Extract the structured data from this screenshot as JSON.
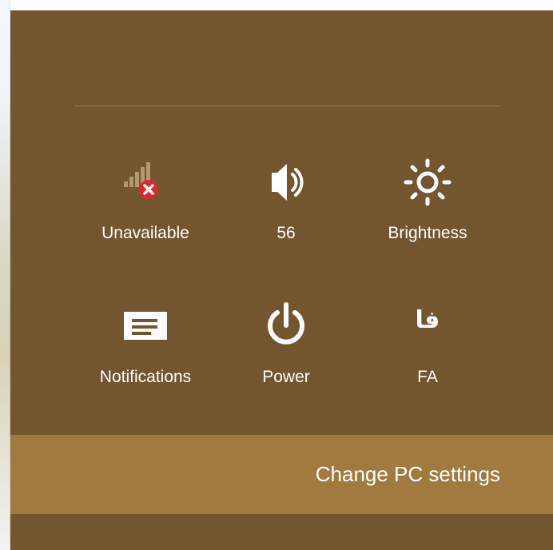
{
  "settings_charm": {
    "quick_settings": [
      {
        "label": "Unavailable",
        "icon": "network-unavailable-icon"
      },
      {
        "label": "56",
        "icon": "volume-icon"
      },
      {
        "label": "Brightness",
        "icon": "brightness-icon"
      },
      {
        "label": "Notifications",
        "icon": "notifications-icon"
      },
      {
        "label": "Power",
        "icon": "power-icon"
      },
      {
        "label": "FA",
        "icon": "keyboard-language-icon",
        "glyph": "فا"
      }
    ],
    "change_pc_settings": "Change PC settings"
  },
  "colors": {
    "panel": "#73552f",
    "settings_bar": "#a07a3e",
    "divider": "#9b8057",
    "error_badge": "#e3232d"
  }
}
